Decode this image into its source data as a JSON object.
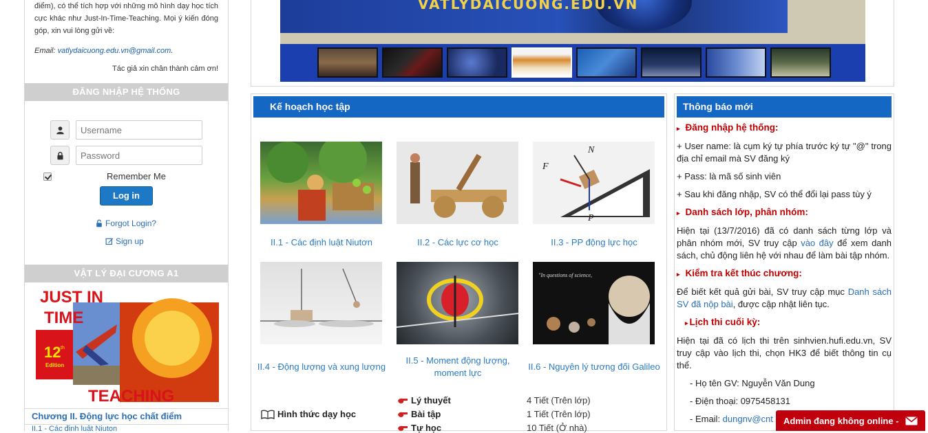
{
  "left": {
    "intro_line1": "điểm), có thể tích hợp với những mô hình dạy học tích cực khác như Just-In-Time-Teaching. Mọi ý kiến đóng góp, xin vui lòng gửi về:",
    "email_label": "Email:",
    "email_value": "vatlydaicuong.edu.vn@gmail.com",
    "thanks": "Tác giả xin chân thành cảm ơn!",
    "login_header": "ĐĂNG NHẬP HỆ THỐNG",
    "username_placeholder": "Username",
    "password_placeholder": "Password",
    "remember_label": "Remember Me",
    "login_button": "Log in",
    "forgot_link": "Forgot Login?",
    "signup_link": "Sign up",
    "course_header": "VẬT LÝ ĐẠI CƯƠNG A1",
    "book_title_1": "JUST IN",
    "book_title_2": "TIME",
    "book_title_3": "TEACHING",
    "book_edition": "12",
    "book_edition_sup": "th",
    "book_edition_word": "Edition",
    "chapter_label": "Chương II. Động lực học chất điểm",
    "chapter_sub": "II.1 - Các định luật Niuton"
  },
  "banner": {
    "site_text": "VATLYDAICUONG.EDU.VN",
    "thumbnails": 8,
    "active_thumbnail": 4
  },
  "center": {
    "header": "Kế hoạch học tập",
    "cards": [
      {
        "caption": "II.1 - Các định luật Niutơn"
      },
      {
        "caption": "II.2 - Các lực cơ học"
      },
      {
        "caption": "II.3 - PP động lực học"
      },
      {
        "caption": "II.4 - Động lượng và xung lượng"
      },
      {
        "caption": "II.5 - Moment động lượng, moment lực"
      },
      {
        "caption": "II.6 - Nguyên lý tương đối Galileo"
      }
    ],
    "methods_title": "Hình thức dạy học",
    "methods": [
      {
        "name": "Lý thuyết",
        "value": "4 Tiết (Trên lớp)"
      },
      {
        "name": "Bài tập",
        "value": "1 Tiết (Trên lớp)"
      },
      {
        "name": "Tự học",
        "value": "10 Tiết (Ở nhà)"
      }
    ]
  },
  "right": {
    "header": "Thông báo mới",
    "h1": "Đăng nhập hệ thống:",
    "p1": "+ User name: là cụm ký tự phía trước ký tự \"@\" trong địa chỉ email mà SV đăng ký",
    "p2": "+ Pass: là mã số sinh viên",
    "p3": "+ Sau khi đăng nhập, SV có thể đổi lại pass tùy ý",
    "h2": "Danh sách lớp, phân nhóm:",
    "p4a": "Hiện tại (13/7/2016) đã có danh sách từng lớp và phân nhóm mới, SV truy cập ",
    "p4link": "vào đây",
    "p4b": " để xem danh sách, chủ động liên hệ với nhau để làm bài tập nhóm.",
    "h3": "Kiểm tra kết thúc chương:",
    "p5a": "Để biết kết quả gửi bài, SV truy cập mục ",
    "p5link": "Danh sách SV đã nộp bài",
    "p5b": ", được cập nhật liên tục.",
    "h4": "Lịch thi cuối kỳ:",
    "p6": "Hiện tại đã có lịch thi trên sinhvien.hufi.edu.vn, SV truy cập vào lịch thi, chọn HK3 để biết thông tin cụ thể.",
    "p7": "- Họ tên GV: Nguyễn Văn Dung",
    "p8": "- Điện thoại: 0975458131",
    "p9_label": "- Email: ",
    "p9_link": "dungnv@cnt"
  },
  "chat": {
    "label": "Admin đang không online -"
  }
}
